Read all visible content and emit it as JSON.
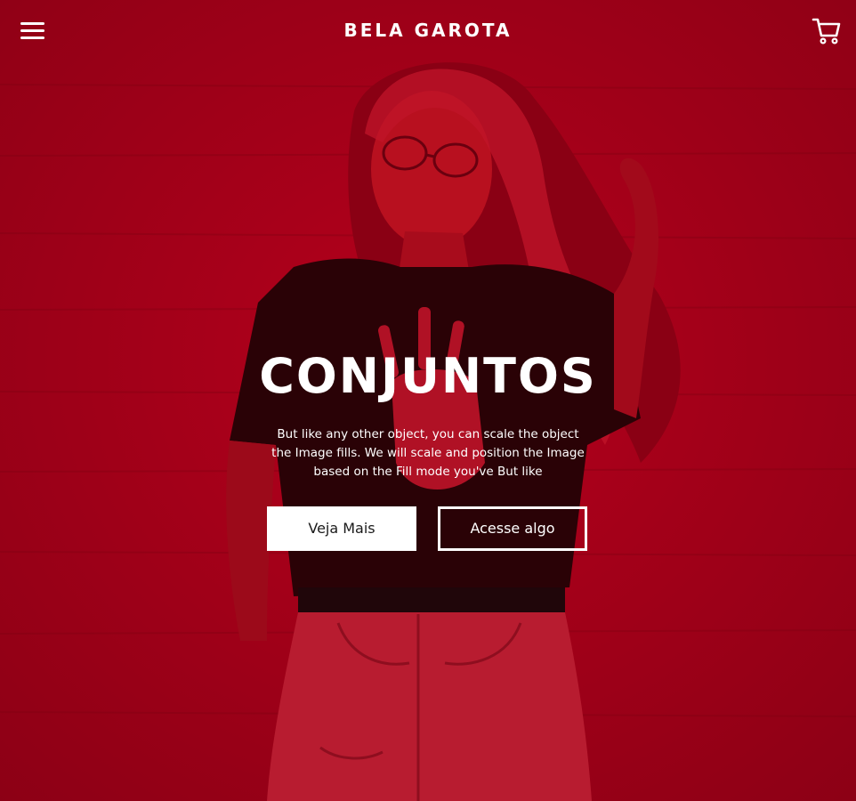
{
  "header": {
    "brand": "BELA GAROTA",
    "menu_icon": "hamburger-menu-icon",
    "cart_icon": "shopping-cart-icon"
  },
  "hero": {
    "title": "CONJUNTOS",
    "description": "But like any other object, you can scale the object the Image fills. We will scale and position the Image based on the Fill mode you've But like",
    "primary_button": "Veja Mais",
    "secondary_button": "Acesse algo",
    "overlay_color": "#a00018",
    "photo": "model-in-black-tshirt-photo"
  }
}
